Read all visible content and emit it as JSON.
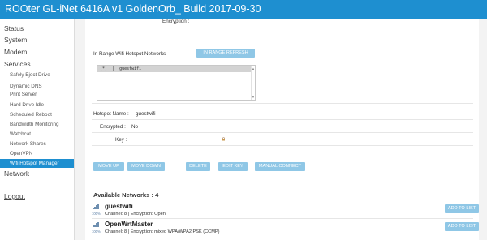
{
  "header": {
    "title": "ROOter GL-iNet 6416A v1      GoldenOrb_ Build 2017-09-30"
  },
  "sidebar": {
    "status": "Status",
    "system": "System",
    "modem": "Modem",
    "services": "Services",
    "services_items": [
      "Safely Eject Drive",
      "Dynamic DNS",
      "Print Server",
      "Hard Drive Idle",
      "Scheduled Reboot",
      "Bandwidth Monitoring",
      "Watchcat",
      "Network Shares",
      "OpenVPN",
      "Wifi Hotspot Manager"
    ],
    "network": "Network",
    "logout": "Logout"
  },
  "form": {
    "encryption_label": "Encryption :",
    "in_range_label": "In Range   Wifi Hotspot Networks",
    "refresh_button": "IN RANGE REFRESH",
    "list_selected": "(*)  |  guestwifi",
    "hotspot_name_label": "Hotspot Name :",
    "hotspot_name_value": "guestwifi",
    "encrypted_label": "Encrypted :",
    "encrypted_value": "No",
    "key_label": "Key :"
  },
  "buttons": {
    "move_up": "MOVE UP",
    "move_down": "MOVE DOWN",
    "delete": "DELETE",
    "edit_key": "EDIT KEY",
    "manual_connect": "MANUAL CONNECT"
  },
  "available": {
    "title": "Available Networks : 4",
    "add_label": "ADD TO LIST",
    "networks": [
      {
        "ssid": "guestwifi",
        "signal": "100%",
        "details": "Channel: 8 | Encryption: Open"
      },
      {
        "ssid": "OpenWrtMaster",
        "signal": "100%",
        "details": "Channel: 8 | Encryption: mixed WPA/WPA2 PSK (CCMP)"
      }
    ]
  },
  "colors": {
    "accent": "#1e8fd0",
    "button": "#8fc7e6"
  }
}
